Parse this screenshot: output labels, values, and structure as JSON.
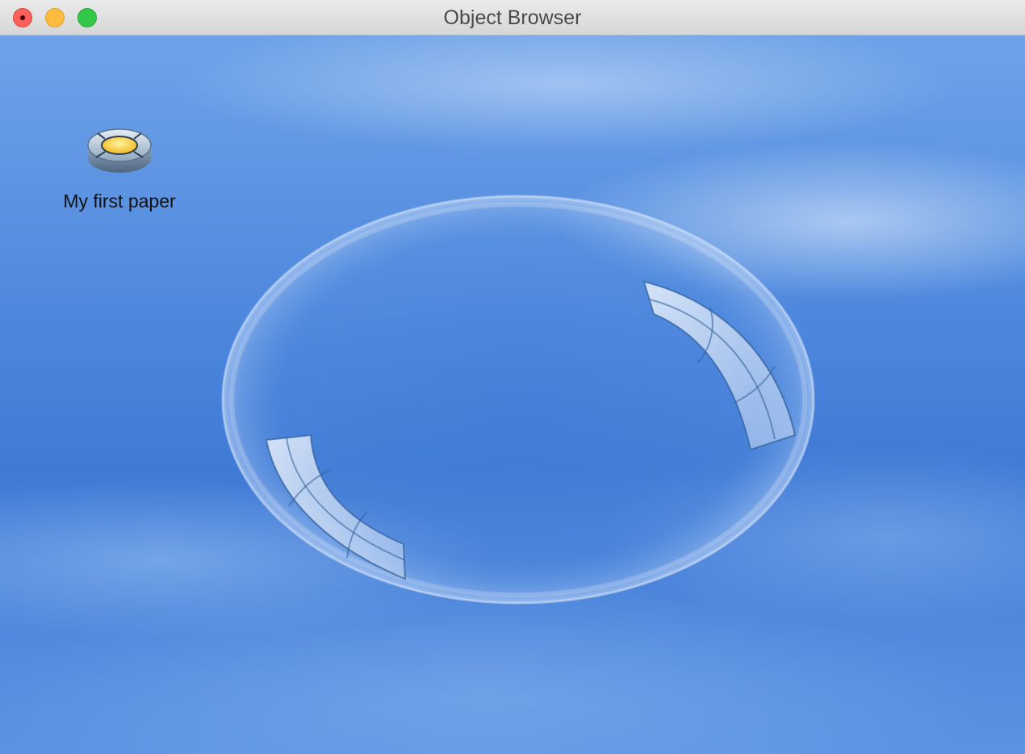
{
  "window": {
    "title": "Object Browser"
  },
  "controls": {
    "close_icon": "close-icon",
    "minimize_icon": "minimize-icon",
    "zoom_icon": "zoom-icon"
  },
  "desktop": {
    "items": [
      {
        "label": "My first paper",
        "icon": "paper-disc-icon"
      }
    ]
  },
  "colors": {
    "sky": "#4d87dd",
    "close": "#fc605b",
    "minimize": "#fdbc40",
    "zoom": "#34c84a",
    "icon_center": "#f7c948"
  }
}
